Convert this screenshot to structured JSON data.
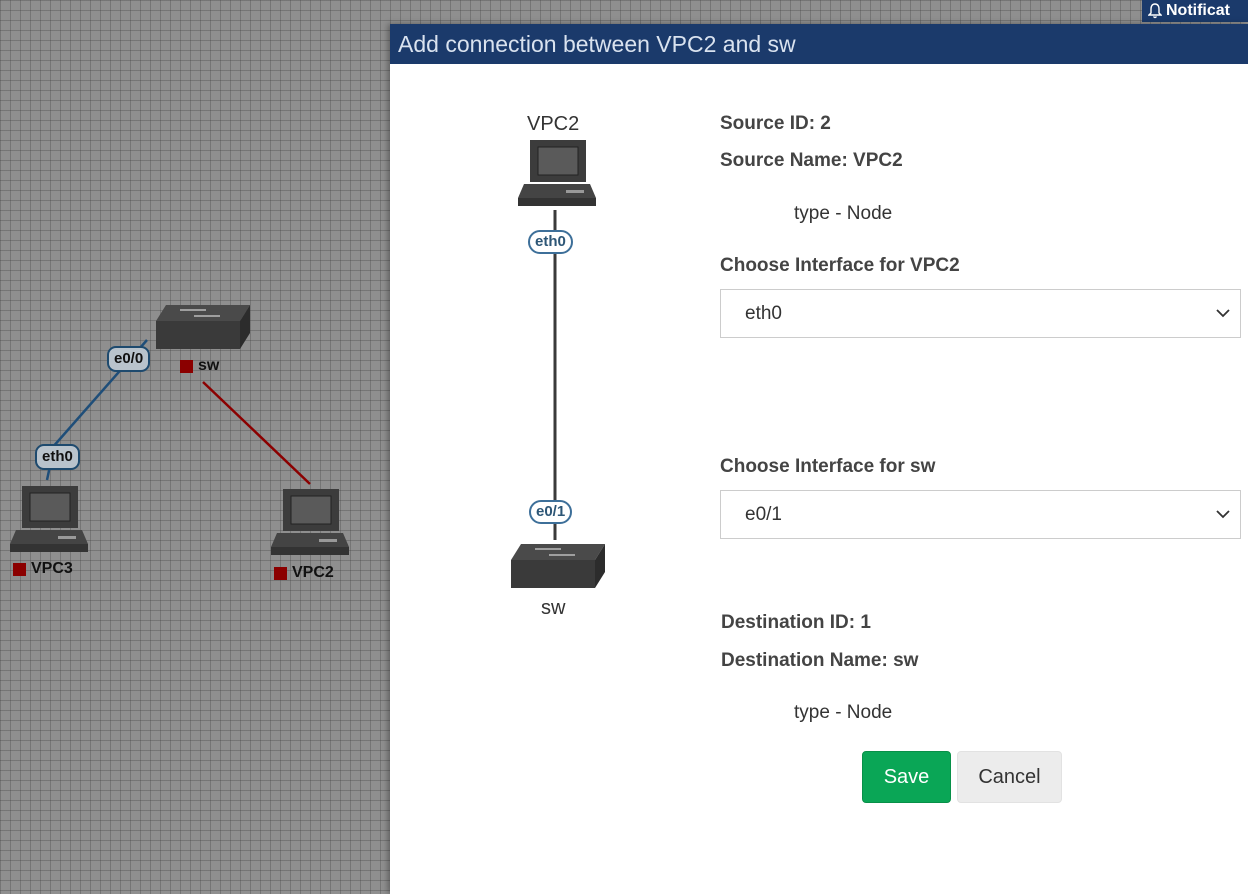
{
  "canvas": {
    "nodes": {
      "sw": {
        "label": "sw"
      },
      "vpc3": {
        "label": "VPC3"
      },
      "vpc2": {
        "label": "VPC2"
      }
    },
    "interfaces": {
      "sw_port": "e0/0",
      "vpc3_port": "eth0"
    },
    "colors": {
      "link_vpc3": "#1f4e79",
      "link_vpc2": "#8b0000",
      "status": "#8b0000"
    }
  },
  "notification": {
    "label": "Notificat",
    "icon": "bell-icon"
  },
  "modal": {
    "title": "Add connection between VPC2 and sw",
    "preview": {
      "top_node": "VPC2",
      "top_iface": "eth0",
      "bottom_iface": "e0/1",
      "bottom_node": "sw"
    },
    "source": {
      "id_text": "Source ID: 2",
      "name_text": "Source Name: VPC2",
      "type_text": "type - Node",
      "choose_label": "Choose Interface for VPC2",
      "selected": "eth0"
    },
    "destination": {
      "choose_label": "Choose Interface for sw",
      "selected": "e0/1",
      "id_text": "Destination ID: 1",
      "name_text": "Destination Name: sw",
      "type_text": "type - Node"
    },
    "buttons": {
      "save": "Save",
      "cancel": "Cancel"
    },
    "colors": {
      "header": "#1b3a6b",
      "save": "#0aa656"
    }
  }
}
